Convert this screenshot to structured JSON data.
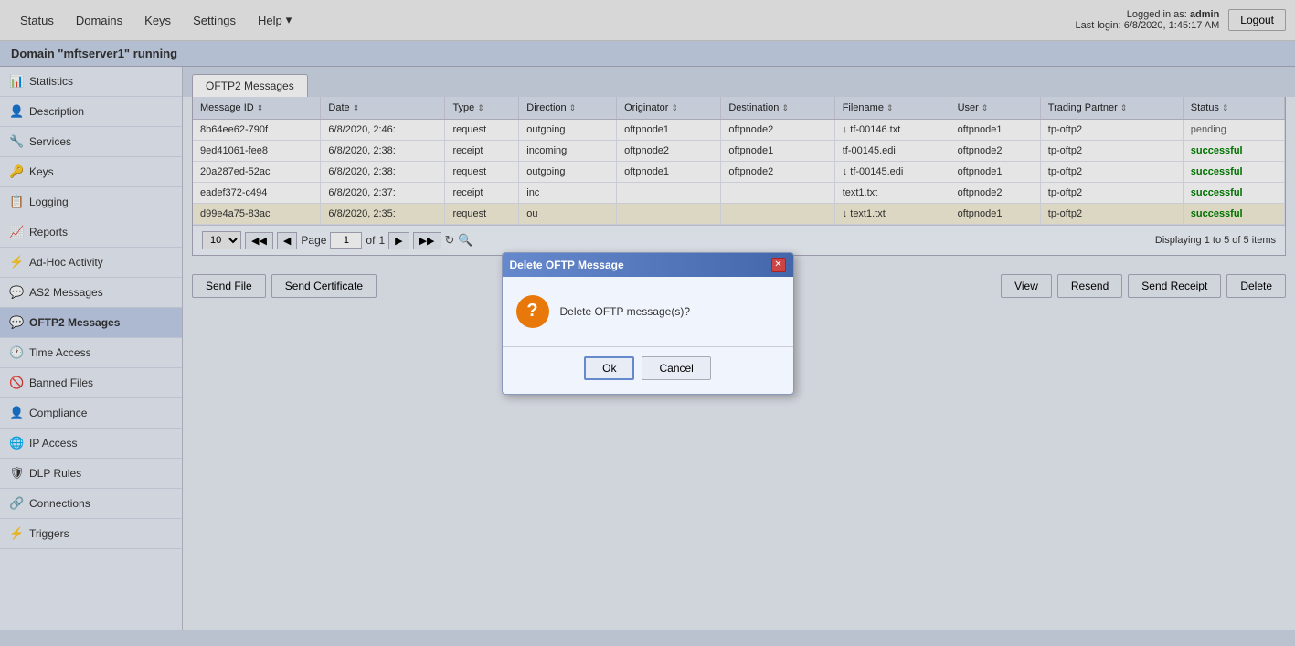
{
  "topNav": {
    "links": [
      "Status",
      "Domains",
      "Keys",
      "Settings",
      "Help"
    ],
    "helpIcon": "▾",
    "loggedInAs": "Logged in as:",
    "username": "admin",
    "lastLogin": "Last login: 6/8/2020, 1:45:17 AM",
    "logoutLabel": "Logout"
  },
  "domainBanner": "Domain \"mftserver1\" running",
  "sidebar": {
    "items": [
      {
        "id": "statistics",
        "icon": "📊",
        "label": "Statistics"
      },
      {
        "id": "description",
        "icon": "👤",
        "label": "Description"
      },
      {
        "id": "services",
        "icon": "🔧",
        "label": "Services"
      },
      {
        "id": "keys",
        "icon": "🔑",
        "label": "Keys"
      },
      {
        "id": "logging",
        "icon": "📋",
        "label": "Logging"
      },
      {
        "id": "reports",
        "icon": "📈",
        "label": "Reports"
      },
      {
        "id": "adhoc",
        "icon": "⚡",
        "label": "Ad-Hoc Activity"
      },
      {
        "id": "as2",
        "icon": "💬",
        "label": "AS2 Messages"
      },
      {
        "id": "oftp2",
        "icon": "💬",
        "label": "OFTP2 Messages"
      },
      {
        "id": "timeaccess",
        "icon": "🕐",
        "label": "Time Access"
      },
      {
        "id": "bannedfiles",
        "icon": "🚫",
        "label": "Banned Files"
      },
      {
        "id": "compliance",
        "icon": "👤",
        "label": "Compliance"
      },
      {
        "id": "ipaccess",
        "icon": "🌐",
        "label": "IP Access"
      },
      {
        "id": "dlp",
        "icon": "🛡",
        "label": "DLP Rules"
      },
      {
        "id": "connections",
        "icon": "🔗",
        "label": "Connections"
      },
      {
        "id": "triggers",
        "icon": "⚡",
        "label": "Triggers"
      }
    ]
  },
  "mainTab": "OFTP2 Messages",
  "table": {
    "columns": [
      "Message ID",
      "Date",
      "Type",
      "Direction",
      "Originator",
      "Destination",
      "Filename",
      "User",
      "Trading Partner",
      "Status"
    ],
    "rows": [
      {
        "id": "8b64ee62-790f",
        "date": "6/8/2020, 2:46:",
        "type": "request",
        "direction": "outgoing",
        "originator": "oftpnode1",
        "destination": "oftpnode2",
        "filename": "↓ tf-00146.txt",
        "user": "oftpnode1",
        "tradingPartner": "tp-oftp2",
        "status": "pending",
        "statusClass": "status-pending",
        "selected": false
      },
      {
        "id": "9ed41061-fee8",
        "date": "6/8/2020, 2:38:",
        "type": "receipt",
        "direction": "incoming",
        "originator": "oftpnode2",
        "destination": "oftpnode1",
        "filename": "tf-00145.edi",
        "user": "oftpnode2",
        "tradingPartner": "tp-oftp2",
        "status": "successful",
        "statusClass": "status-success",
        "selected": false
      },
      {
        "id": "20a287ed-52ac",
        "date": "6/8/2020, 2:38:",
        "type": "request",
        "direction": "outgoing",
        "originator": "oftpnode1",
        "destination": "oftpnode2",
        "filename": "↓ tf-00145.edi",
        "user": "oftpnode1",
        "tradingPartner": "tp-oftp2",
        "status": "successful",
        "statusClass": "status-success",
        "selected": false
      },
      {
        "id": "eadef372-c494",
        "date": "6/8/2020, 2:37:",
        "type": "receipt",
        "direction": "inc",
        "originator": "",
        "destination": "",
        "filename": "text1.txt",
        "user": "oftpnode2",
        "tradingPartner": "tp-oftp2",
        "status": "successful",
        "statusClass": "status-success",
        "selected": false
      },
      {
        "id": "d99e4a75-83ac",
        "date": "6/8/2020, 2:35:",
        "type": "request",
        "direction": "ou",
        "originator": "",
        "destination": "",
        "filename": "↓ text1.txt",
        "user": "oftpnode1",
        "tradingPartner": "tp-oftp2",
        "status": "successful",
        "statusClass": "status-success",
        "selected": true
      }
    ]
  },
  "pagination": {
    "perPage": "10",
    "page": "1",
    "ofLabel": "of",
    "totalPages": "1",
    "displayText": "Displaying 1 to 5 of 5 items"
  },
  "bottomButtons": {
    "sendFile": "Send File",
    "sendCertificate": "Send Certificate",
    "view": "View",
    "resend": "Resend",
    "sendReceipt": "Send Receipt",
    "delete": "Delete"
  },
  "dialog": {
    "title": "Delete OFTP Message",
    "message": "Delete OFTP message(s)?",
    "okLabel": "Ok",
    "cancelLabel": "Cancel",
    "warningIcon": "?"
  }
}
